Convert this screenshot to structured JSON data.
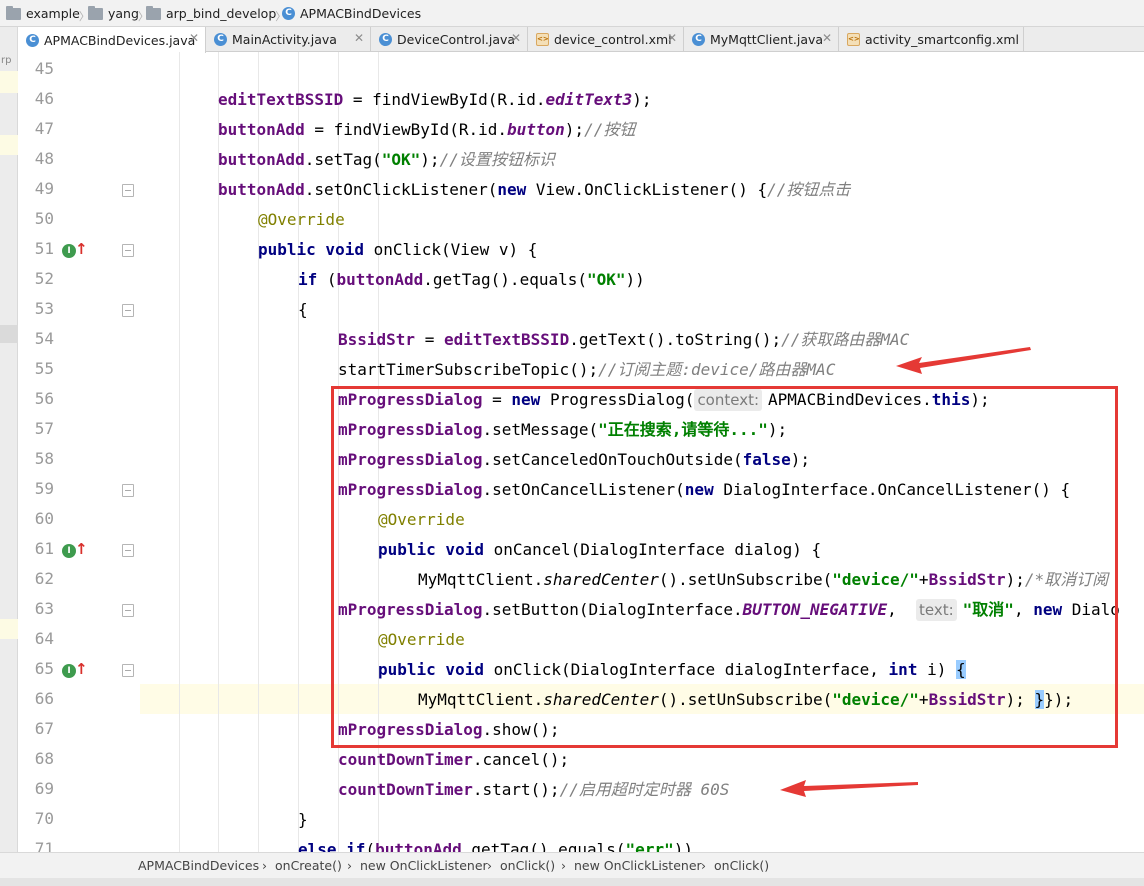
{
  "breadcrumb": [
    {
      "label": "example",
      "icon": "folder-icon"
    },
    {
      "label": "yang",
      "icon": "folder-icon"
    },
    {
      "label": "arp_bind_develop",
      "icon": "folder-icon"
    },
    {
      "label": "APMACBindDevices",
      "icon": "class-icon"
    }
  ],
  "tabs": [
    {
      "label": "APMACBindDevices.java",
      "icon": "class-icon",
      "active": true
    },
    {
      "label": "MainActivity.java",
      "icon": "class-icon",
      "active": false
    },
    {
      "label": "DeviceControl.java",
      "icon": "class-icon",
      "active": false
    },
    {
      "label": "device_control.xml",
      "icon": "xml-icon",
      "active": false
    },
    {
      "label": "MyMqttClient.java",
      "icon": "class-icon",
      "active": false
    },
    {
      "label": "activity_smartconfig.xml",
      "icon": "xml-icon",
      "active": false
    }
  ],
  "left_strip_label": "rp",
  "editor": {
    "caret_line": 66,
    "code": [
      {
        "n": "45",
        "t": []
      },
      {
        "n": "46",
        "t": [
          [
            "field",
            "editTextBSSID"
          ],
          [
            "p",
            " = findViewById(R.id."
          ],
          [
            "stat",
            "editText3"
          ],
          [
            "p",
            ");"
          ]
        ]
      },
      {
        "n": "47",
        "t": [
          [
            "field",
            "buttonAdd"
          ],
          [
            "p",
            " = findViewById(R.id."
          ],
          [
            "stat",
            "button"
          ],
          [
            "p",
            ");"
          ],
          [
            "cmt",
            "//按钮"
          ]
        ]
      },
      {
        "n": "48",
        "t": [
          [
            "field",
            "buttonAdd"
          ],
          [
            "p",
            ".setTag("
          ],
          [
            "str",
            "\"OK\""
          ],
          [
            "p",
            ");"
          ],
          [
            "cmt",
            "//设置按钮标识"
          ]
        ]
      },
      {
        "n": "49",
        "t": [
          [
            "field",
            "buttonAdd"
          ],
          [
            "p",
            ".setOnClickListener("
          ],
          [
            "kw",
            "new"
          ],
          [
            "p",
            " View.OnClickListener() {"
          ],
          [
            "cmt",
            "//按钮点击"
          ]
        ]
      },
      {
        "n": "50",
        "t": [
          [
            "ann",
            "@Override"
          ]
        ]
      },
      {
        "n": "51",
        "t": [
          [
            "kw",
            "public void"
          ],
          [
            "p",
            " onClick(View v) {"
          ]
        ]
      },
      {
        "n": "52",
        "t": [
          [
            "kw",
            "if"
          ],
          [
            "p",
            " ("
          ],
          [
            "field",
            "buttonAdd"
          ],
          [
            "p",
            ".getTag().equals("
          ],
          [
            "str",
            "\"OK\""
          ],
          [
            "p",
            "))"
          ]
        ]
      },
      {
        "n": "53",
        "t": [
          [
            "p",
            "{"
          ]
        ]
      },
      {
        "n": "54",
        "t": [
          [
            "field",
            "BssidStr"
          ],
          [
            "p",
            " = "
          ],
          [
            "field",
            "editTextBSSID"
          ],
          [
            "p",
            ".getText().toString();"
          ],
          [
            "cmt",
            "//获取路由器MAC"
          ]
        ]
      },
      {
        "n": "55",
        "t": [
          [
            "p",
            "startTimerSubscribeTopic();"
          ],
          [
            "cmt",
            "//订阅主题:device/路由器MAC"
          ]
        ]
      },
      {
        "n": "56",
        "t": [
          [
            "field",
            "mProgressDialog"
          ],
          [
            "p",
            " = "
          ],
          [
            "kw",
            "new"
          ],
          [
            "p",
            " ProgressDialog("
          ],
          [
            "hint",
            "context:"
          ],
          [
            "p",
            "APMACBindDevices."
          ],
          [
            "kw",
            "this"
          ],
          [
            "p",
            ");"
          ]
        ]
      },
      {
        "n": "57",
        "t": [
          [
            "field",
            "mProgressDialog"
          ],
          [
            "p",
            ".setMessage("
          ],
          [
            "str",
            "\"正在搜索,请等待...\""
          ],
          [
            "p",
            ");"
          ]
        ]
      },
      {
        "n": "58",
        "t": [
          [
            "field",
            "mProgressDialog"
          ],
          [
            "p",
            ".setCanceledOnTouchOutside("
          ],
          [
            "kw",
            "false"
          ],
          [
            "p",
            ");"
          ]
        ]
      },
      {
        "n": "59",
        "t": [
          [
            "field",
            "mProgressDialog"
          ],
          [
            "p",
            ".setOnCancelListener("
          ],
          [
            "kw",
            "new"
          ],
          [
            "p",
            " DialogInterface.OnCancelListener() {"
          ]
        ]
      },
      {
        "n": "60",
        "t": [
          [
            "ann",
            "@Override"
          ]
        ]
      },
      {
        "n": "61",
        "t": [
          [
            "kw",
            "public void"
          ],
          [
            "p",
            " onCancel(DialogInterface dialog) {"
          ]
        ]
      },
      {
        "n": "62",
        "t": [
          [
            "p",
            "MyMqttClient."
          ],
          [
            "ital",
            "sharedCenter"
          ],
          [
            "p",
            "().setUnSubscribe("
          ],
          [
            "str",
            "\"device/\""
          ],
          [
            "p",
            "+"
          ],
          [
            "field",
            "BssidStr"
          ],
          [
            "p",
            ");"
          ],
          [
            "cmt",
            "/*取消订阅"
          ]
        ]
      },
      {
        "n": "63",
        "t": [
          [
            "field",
            "mProgressDialog"
          ],
          [
            "p",
            ".setButton(DialogInterface."
          ],
          [
            "stat",
            "BUTTON_NEGATIVE"
          ],
          [
            "p",
            ",  "
          ],
          [
            "hint",
            "text:"
          ],
          [
            "str",
            "\"取消\""
          ],
          [
            "p",
            ", "
          ],
          [
            "kw",
            "new"
          ],
          [
            "p",
            " Dialo"
          ]
        ]
      },
      {
        "n": "64",
        "t": [
          [
            "ann",
            "@Override"
          ]
        ]
      },
      {
        "n": "65",
        "t": [
          [
            "kw",
            "public void"
          ],
          [
            "p",
            " onClick(DialogInterface dialogInterface, "
          ],
          [
            "kw",
            "int"
          ],
          [
            "p",
            " i) "
          ],
          [
            "brace",
            "{"
          ]
        ]
      },
      {
        "n": "66",
        "t": [
          [
            "p",
            "MyMqttClient."
          ],
          [
            "ital",
            "sharedCenter"
          ],
          [
            "p",
            "().setUnSubscribe("
          ],
          [
            "str",
            "\"device/\""
          ],
          [
            "p",
            "+"
          ],
          [
            "field",
            "BssidStr"
          ],
          [
            "p",
            "); "
          ],
          [
            "brace",
            "}"
          ],
          [
            "p",
            "});"
          ]
        ]
      },
      {
        "n": "67",
        "t": [
          [
            "field",
            "mProgressDialog"
          ],
          [
            "p",
            ".show();"
          ]
        ]
      },
      {
        "n": "68",
        "t": [
          [
            "field",
            "countDownTimer"
          ],
          [
            "p",
            ".cancel();"
          ]
        ]
      },
      {
        "n": "69",
        "t": [
          [
            "field",
            "countDownTimer"
          ],
          [
            "p",
            ".start();"
          ],
          [
            "cmt",
            "//启用超时定时器 60S"
          ]
        ]
      },
      {
        "n": "70",
        "t": [
          [
            "p",
            "}"
          ]
        ]
      },
      {
        "n": "71",
        "t": [
          [
            "kw",
            "else if"
          ],
          [
            "p",
            "("
          ],
          [
            "field",
            "buttonAdd"
          ],
          [
            "p",
            ".getTag().equals("
          ],
          [
            "str",
            "\"err\""
          ],
          [
            "p",
            "))"
          ]
        ]
      }
    ]
  },
  "bottom_breadcrumb": [
    "APMACBindDevices",
    "onCreate()",
    "new OnClickListener",
    "onClick()",
    "new OnClickListener",
    "onClick()"
  ],
  "colors": {
    "field": "#660e7a",
    "keyword": "#000080",
    "string": "#008000",
    "comment": "#808080",
    "annotation": "#808000",
    "highlight_box": "#e53935",
    "caret_row": "#fffce6"
  }
}
